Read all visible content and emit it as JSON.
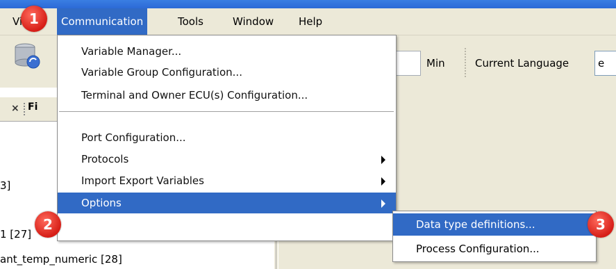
{
  "menubar": {
    "items": [
      "View",
      "Communication",
      "Tools",
      "Window",
      "Help"
    ],
    "active_index": 1
  },
  "toolbar": {
    "min_label": "Min",
    "current_language_label": "Current Language",
    "language_value": "e"
  },
  "left_panel": {
    "tab_label": "Fi",
    "lines": [
      "3]",
      "1 [27]",
      "ant_temp_numeric [28]"
    ]
  },
  "communication_menu": {
    "items": [
      {
        "label": "Variable Manager...",
        "submenu": false
      },
      {
        "label": "Variable Group Configuration...",
        "submenu": false
      },
      {
        "label": "Terminal and Owner ECU(s) Configuration...",
        "submenu": false
      },
      {
        "label": "Port Configuration...",
        "submenu": false
      },
      {
        "label": "Protocols",
        "submenu": true
      },
      {
        "label": "Import Export Variables",
        "submenu": true
      },
      {
        "label": "Options",
        "submenu": true,
        "highlighted": true
      }
    ]
  },
  "options_submenu": {
    "items": [
      {
        "label": "Data type definitions...",
        "highlighted": true
      },
      {
        "label": "Process Configuration...",
        "highlighted": false
      }
    ]
  },
  "callouts": [
    "1",
    "2",
    "3"
  ],
  "colors": {
    "highlight": "#316ac5",
    "callout": "#e0261d",
    "menubar": "#ece9d8"
  }
}
